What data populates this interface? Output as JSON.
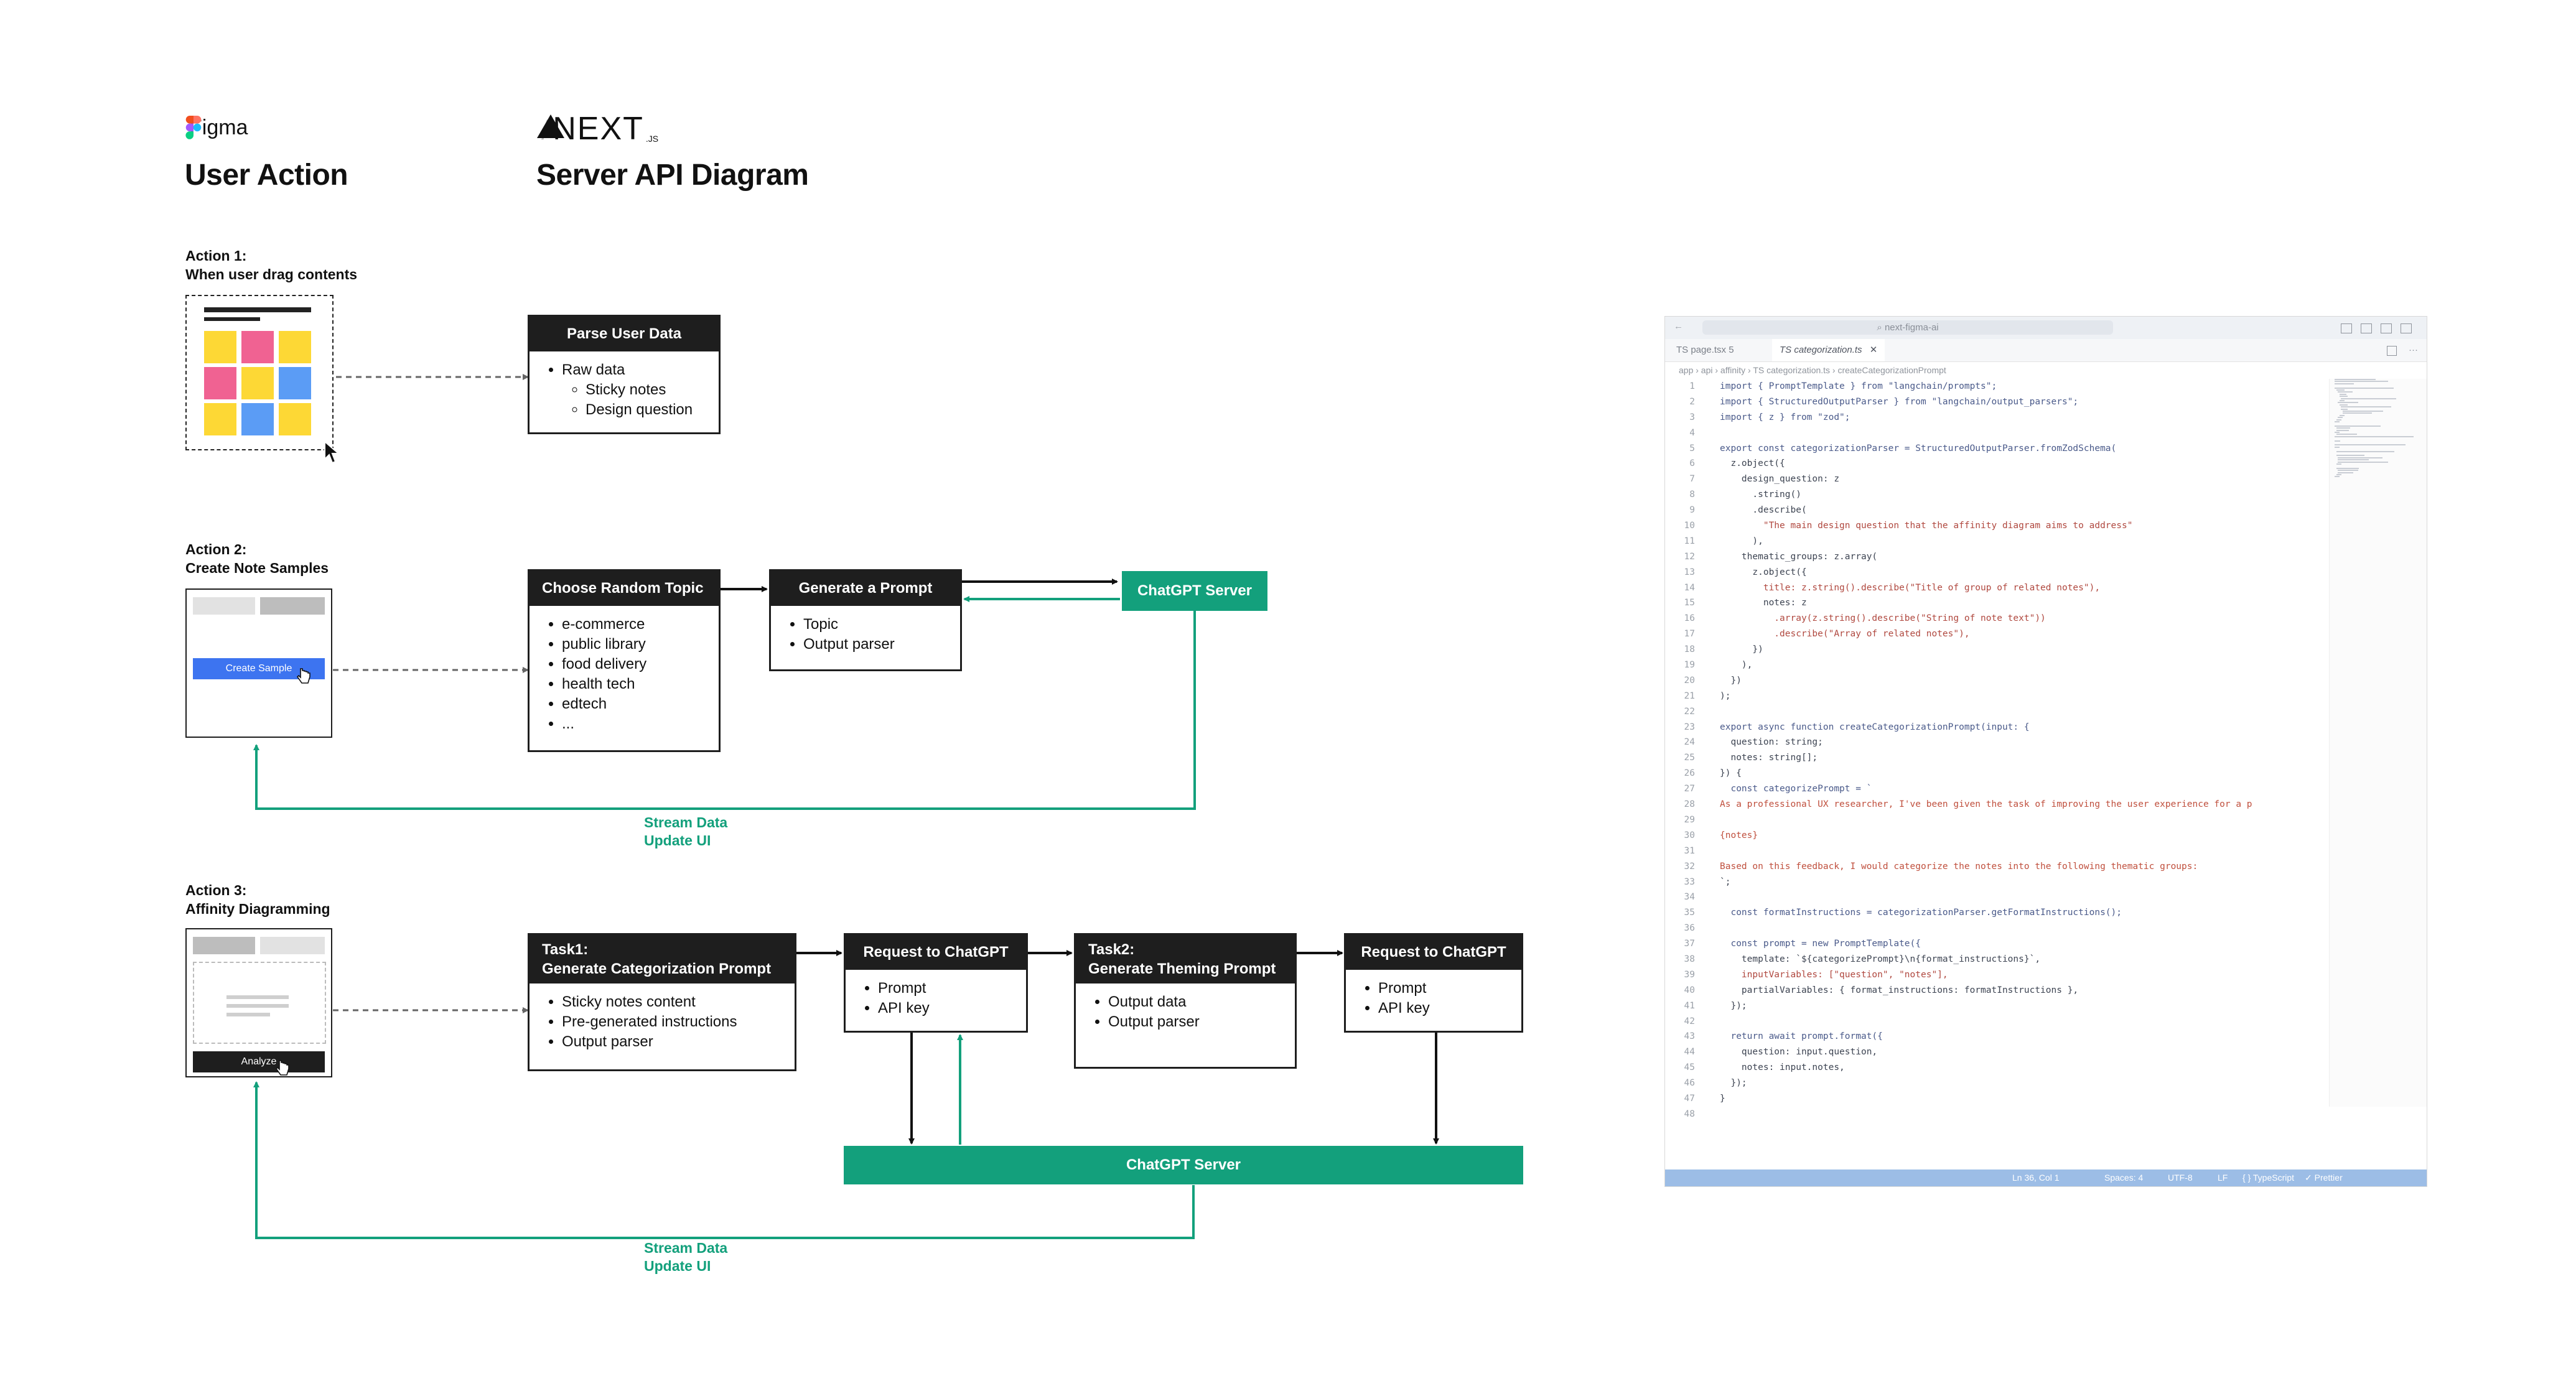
{
  "colors": {
    "accent_green": "#13a07c",
    "box_dark": "#1e1e1e",
    "arrow": "#111111",
    "dashed": "#666666",
    "button_blue": "#3d74f0"
  },
  "header": {
    "figma_brand": "Figma",
    "next_brand": "NEXT",
    "next_suffix": ".JS",
    "left_title": "User Action",
    "right_title": "Server API Diagram"
  },
  "action1": {
    "title_line1": "Action 1:",
    "title_line2": "When user drag contents",
    "box_title": "Parse User Data",
    "items": [
      "Raw data"
    ],
    "subitems": [
      "Sticky notes",
      "Design question"
    ]
  },
  "action2": {
    "title_line1": "Action 2:",
    "title_line2": "Create Note Samples",
    "button_label": "Create Sample",
    "topic_box_title": "Choose Random Topic",
    "topics": [
      "e-commerce",
      "public library",
      "food delivery",
      "health tech",
      "edtech",
      "..."
    ],
    "prompt_box_title": "Generate a Prompt",
    "prompt_items": [
      "Topic",
      "Output parser"
    ],
    "server_label": "ChatGPT Server",
    "stream_line1": "Stream Data",
    "stream_line2": "Update UI"
  },
  "action3": {
    "title_line1": "Action 3:",
    "title_line2": "Affinity Diagramming",
    "button_label": "Analyze",
    "task1_line1": "Task1:",
    "task1_line2": "Generate Categorization Prompt",
    "task1_items": [
      "Sticky notes content",
      "Pre-generated instructions",
      "Output parser"
    ],
    "request1_title": "Request to ChatGPT",
    "request1_items": [
      "Prompt",
      "API key"
    ],
    "task2_line1": "Task2:",
    "task2_line2": "Generate Theming Prompt",
    "task2_items": [
      "Output data",
      "Output parser"
    ],
    "request2_title": "Request to ChatGPT",
    "request2_items": [
      "Prompt",
      "API key"
    ],
    "server_label": "ChatGPT Server",
    "stream_line1": "Stream Data",
    "stream_line2": "Update UI"
  },
  "editor": {
    "search_text": "next-figma-ai",
    "tabs": [
      {
        "label": "TS page.tsx 5",
        "active": false
      },
      {
        "label": "TS categorization.ts",
        "active": true
      }
    ],
    "breadcrumb": "app › api › affinity › TS categorization.ts › createCategorizationPrompt",
    "code_lines": [
      "import { PromptTemplate } from \"langchain/prompts\";",
      "import { StructuredOutputParser } from \"langchain/output_parsers\";",
      "import { z } from \"zod\";",
      "",
      "export const categorizationParser = StructuredOutputParser.fromZodSchema(",
      "  z.object({",
      "    design_question: z",
      "      .string()",
      "      .describe(",
      "        \"The main design question that the affinity diagram aims to address\"",
      "      ),",
      "    thematic_groups: z.array(",
      "      z.object({",
      "        title: z.string().describe(\"Title of group of related notes\"),",
      "        notes: z",
      "          .array(z.string().describe(\"String of note text\"))",
      "          .describe(\"Array of related notes\"),",
      "      })",
      "    ),",
      "  })",
      ");",
      "",
      "export async function createCategorizationPrompt(input: {",
      "  question: string;",
      "  notes: string[];",
      "}) {",
      "  const categorizePrompt = `",
      "As a professional UX researcher, I've been given the task of improving the user experience for a p",
      "",
      "{notes}",
      "",
      "Based on this feedback, I would categorize the notes into the following thematic groups:",
      "`;",
      "",
      "  const formatInstructions = categorizationParser.getFormatInstructions();",
      "",
      "  const prompt = new PromptTemplate({",
      "    template: `${categorizePrompt}\\n{format_instructions}`,",
      "    inputVariables: [\"question\", \"notes\"],",
      "    partialVariables: { format_instructions: formatInstructions },",
      "  });",
      "",
      "  return await prompt.format({",
      "    question: input.question,",
      "    notes: input.notes,",
      "  });",
      "}",
      ""
    ],
    "status_items": [
      "Ln 36, Col 1",
      "Spaces: 4",
      "UTF-8",
      "LF",
      "{ } TypeScript",
      "✓ Prettier"
    ]
  }
}
